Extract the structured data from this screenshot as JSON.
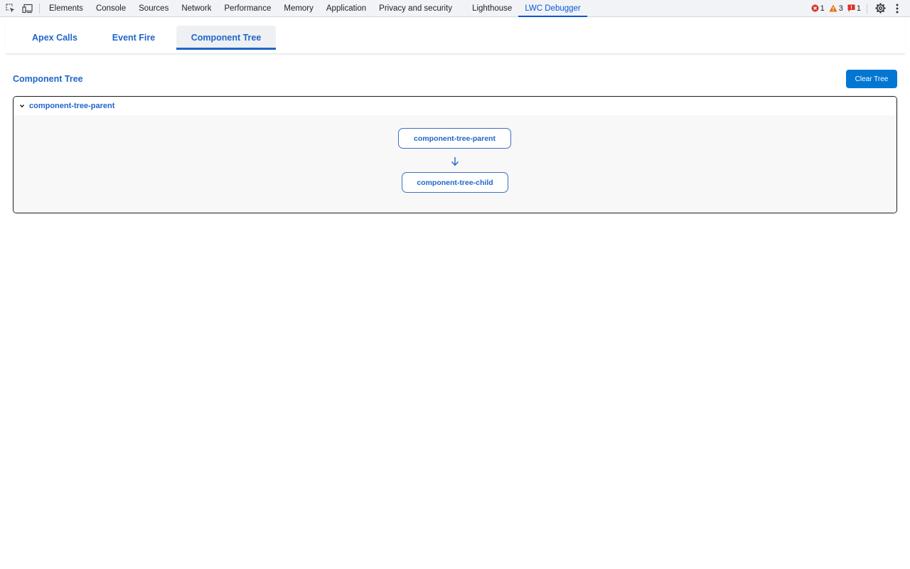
{
  "devtools": {
    "tabs": [
      {
        "label": "Elements"
      },
      {
        "label": "Console"
      },
      {
        "label": "Sources"
      },
      {
        "label": "Network"
      },
      {
        "label": "Performance"
      },
      {
        "label": "Memory"
      },
      {
        "label": "Application"
      },
      {
        "label": "Privacy and security"
      },
      {
        "label": "Lighthouse"
      },
      {
        "label": "LWC Debugger"
      }
    ],
    "active_tab": "LWC Debugger",
    "error_count": "1",
    "warning_count": "3",
    "issue_count": "1",
    "icons": {
      "inspect": "inspect-element-icon",
      "device": "device-toolbar-icon",
      "error": "error-icon",
      "warning": "warning-icon",
      "issue": "issue-icon",
      "settings": "gear-icon",
      "more": "more-vertical-icon"
    }
  },
  "panel": {
    "tabs": [
      {
        "label": "Apex Calls"
      },
      {
        "label": "Event Fire"
      },
      {
        "label": "Component Tree"
      }
    ],
    "active_tab": "Component Tree"
  },
  "content": {
    "title": "Component Tree",
    "clear_button": "Clear Tree",
    "tree": {
      "root_label": "component-tree-parent",
      "nodes": [
        {
          "label": "component-tree-parent"
        },
        {
          "label": "component-tree-child"
        }
      ]
    }
  },
  "colors": {
    "accent": "#1f66c9",
    "button": "#0176d3",
    "error": "#d93025",
    "warning": "#e8710a"
  }
}
